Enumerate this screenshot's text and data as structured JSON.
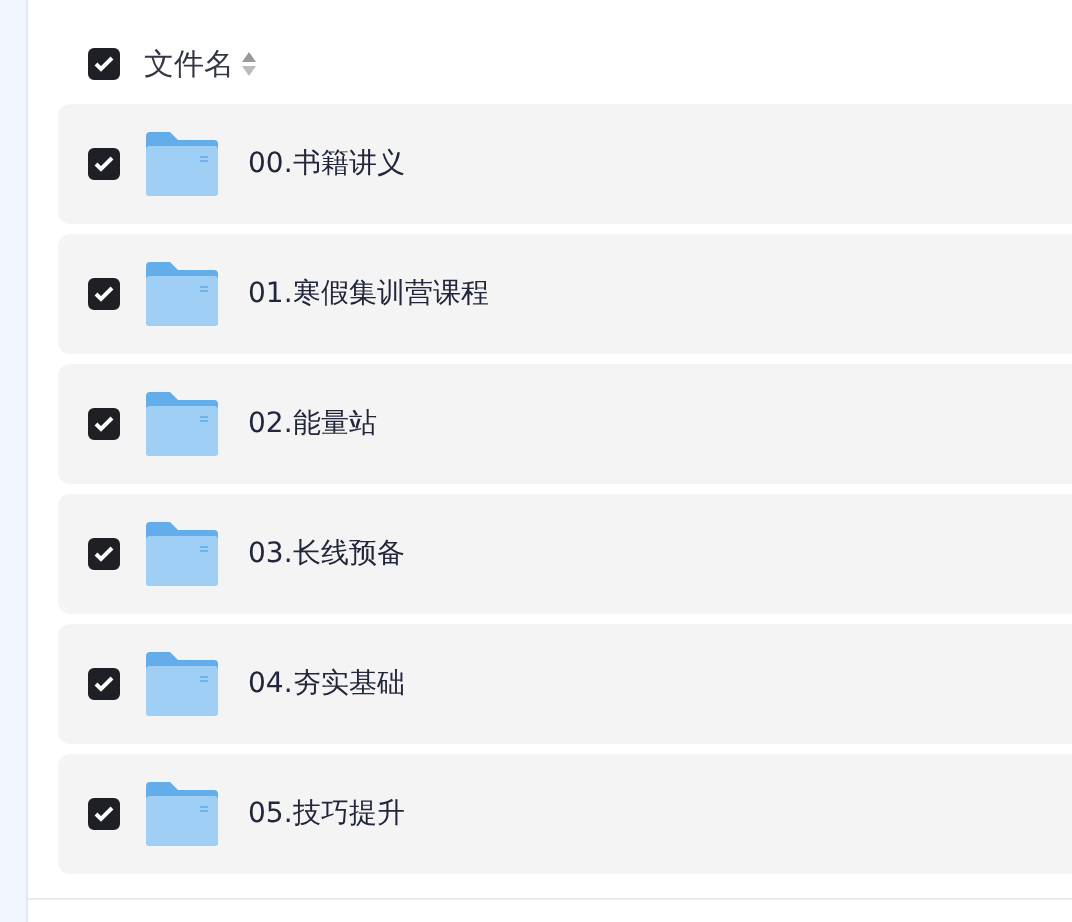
{
  "header": {
    "label": "文件名",
    "checked": true
  },
  "files": [
    {
      "name": "00.书籍讲义",
      "checked": true
    },
    {
      "name": "01.寒假集训营课程",
      "checked": true
    },
    {
      "name": "02.能量站",
      "checked": true
    },
    {
      "name": "03.长线预备",
      "checked": true
    },
    {
      "name": "04.夯实基础",
      "checked": true
    },
    {
      "name": "05.技巧提升",
      "checked": true
    }
  ]
}
